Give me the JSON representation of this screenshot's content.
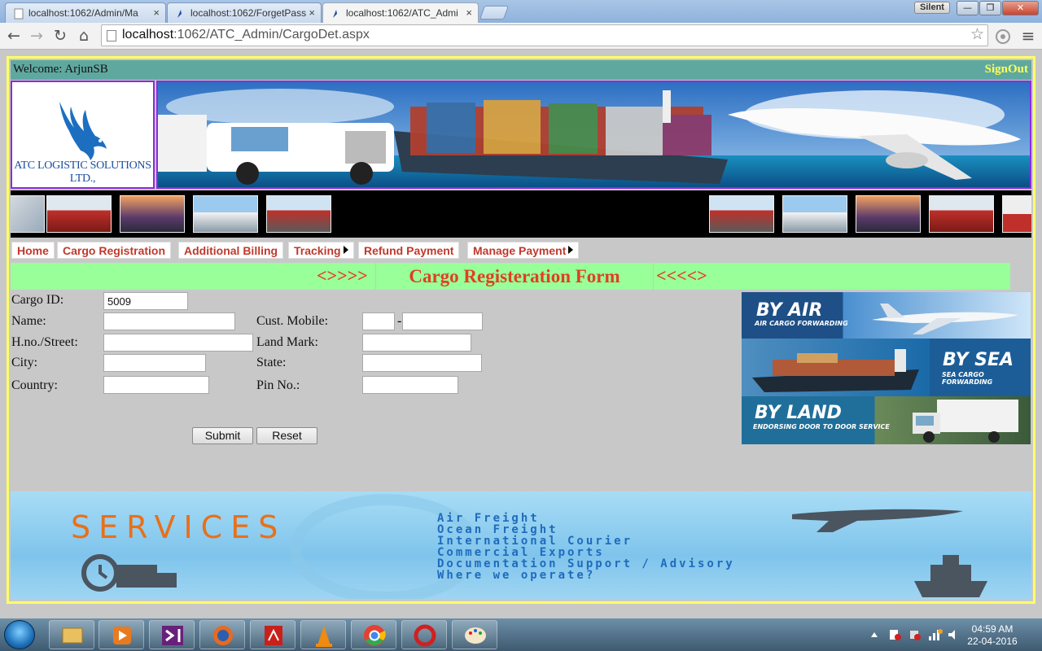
{
  "browser": {
    "tabs": [
      {
        "title": "localhost:1062/Admin/Ma",
        "active": false
      },
      {
        "title": "localhost:1062/ForgetPass",
        "active": false
      },
      {
        "title": "localhost:1062/ATC_Admi",
        "active": true
      }
    ],
    "tab_close": "×",
    "silent_label": "Silent",
    "window_buttons": {
      "minimize": "—",
      "maximize": "❐",
      "close": "✕"
    },
    "nav": {
      "back": "←",
      "forward": "→",
      "reload": "↻",
      "home": "⌂"
    },
    "url_host": "localhost",
    "url_rest": ":1062/ATC_Admin/CargoDet.aspx",
    "star": "☆",
    "menu_glyph": "≡"
  },
  "header": {
    "welcome": "Welcome: ArjunSB",
    "signout": "SignOut",
    "company": "ATC LOGISTIC SOLUTIONS LTD.,"
  },
  "menu": [
    {
      "label": "Home",
      "has_submenu": false
    },
    {
      "label": "Cargo Registration",
      "has_submenu": false
    },
    {
      "label": "Additional Billing",
      "has_submenu": false
    },
    {
      "label": "Tracking",
      "has_submenu": true
    },
    {
      "label": "Refund Payment",
      "has_submenu": false
    },
    {
      "label": "Manage Payment",
      "has_submenu": true
    }
  ],
  "form": {
    "title_left": "<>>>>",
    "title": "Cargo Registeration Form",
    "title_right": "<<<<>",
    "cargo_id_label": "Cargo ID:",
    "cargo_id_value": "5009",
    "name_label": "Name:",
    "name_value": "",
    "mobile_label": "Cust. Mobile:",
    "mobile_code_value": "",
    "mobile_dash": "-",
    "mobile_number_value": "",
    "street_label": "H.no./Street:",
    "street_value": "",
    "landmark_label": "Land Mark:",
    "landmark_value": "",
    "city_label": "City:",
    "city_value": "",
    "state_label": "State:",
    "state_value": "",
    "country_label": "Country:",
    "country_value": "",
    "pin_label": "Pin No.:",
    "pin_value": "",
    "submit_label": "Submit",
    "reset_label": "Reset"
  },
  "ads": {
    "air": {
      "title": "BY AIR",
      "sub": "AIR CARGO FORWARDING"
    },
    "sea": {
      "title": "BY SEA",
      "sub": "SEA CARGO FORWARDING"
    },
    "land": {
      "title": "BY LAND",
      "sub": "ENDORSING DOOR TO DOOR SERVICE"
    }
  },
  "services": {
    "title": "SERVICES",
    "items": [
      "Air Freight",
      "Ocean Freight",
      "International Courier",
      "Commercial Exports",
      "Documentation Support / Advisory",
      "Where we operate?"
    ]
  },
  "taskbar": {
    "time": "04:59 AM",
    "date": "22-04-2016"
  },
  "colors": {
    "welcome_bar": "#5fa8a0",
    "signout": "#ffff55",
    "title_bar": "#99ff99",
    "title_text": "#e04020",
    "menu_text": "#c0392b",
    "page_border": "#ffff66",
    "banner_border": "#8a2be2"
  }
}
